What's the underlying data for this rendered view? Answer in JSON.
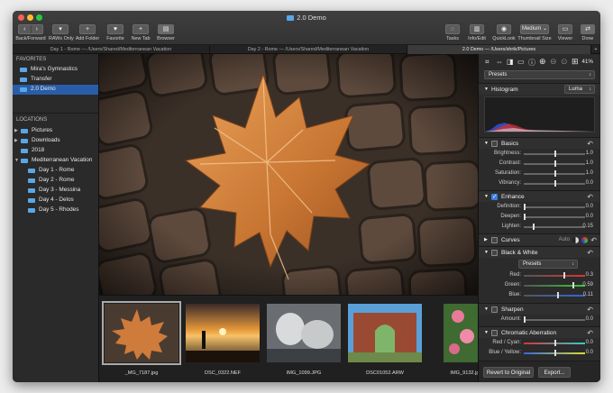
{
  "window": {
    "title": "2.0 Demo",
    "traffic_lights": {
      "close": "#fe5f57",
      "minimize": "#febc2e",
      "zoom": "#28c840"
    }
  },
  "toolbar": {
    "back_forward": "Back/Forward",
    "raws_only": "RAWs Only",
    "add_folder": "Add Folder",
    "favorite": "Favorite",
    "new_tab": "New Tab",
    "browser": "Browser",
    "tasks": "Tasks",
    "info_edit": "Info/Edit",
    "quicklook": "QuickLook",
    "thumbnail_size_value": "Medium",
    "thumbnail_size": "Thumbnail Size",
    "viewer": "Viewer",
    "done": "Done"
  },
  "tabs": [
    {
      "label": "Day 1 - Rome  —  /Users/Shared/Mediterranean Vacation",
      "active": false
    },
    {
      "label": "Day 2 - Rome  —  /Users/Shared/Mediterranean Vacation",
      "active": false
    },
    {
      "label": "2.0 Demo  —  /Users/shrik/Pictures",
      "active": true
    }
  ],
  "sidebar": {
    "favorites_header": "FAVORITES",
    "favorites": [
      {
        "label": "Mira's Gymnastics",
        "selected": false
      },
      {
        "label": "Transfer",
        "selected": false
      },
      {
        "label": "2.0 Demo",
        "selected": true
      }
    ],
    "locations_header": "LOCATIONS",
    "locations": [
      {
        "label": "Pictures",
        "expandable": true,
        "level": 0
      },
      {
        "label": "Downloads",
        "expandable": true,
        "level": 0
      },
      {
        "label": "2018",
        "expandable": false,
        "level": 0
      },
      {
        "label": "Mediterranean Vacation",
        "expandable": true,
        "expanded": true,
        "level": 0
      },
      {
        "label": "Day 1 - Rome",
        "level": 1
      },
      {
        "label": "Day 2 - Rome",
        "level": 1
      },
      {
        "label": "Day 3 - Messina",
        "level": 1
      },
      {
        "label": "Day 4 - Delos",
        "level": 1
      },
      {
        "label": "Day 5 - Rhodes",
        "level": 1
      }
    ]
  },
  "filmstrip": [
    {
      "name": "_MG_7187.jpg",
      "selected": true
    },
    {
      "name": "DSC_0322.NEF",
      "selected": false
    },
    {
      "name": "IMG_1099.JPG",
      "selected": false
    },
    {
      "name": "DSC01052.ARW",
      "selected": false
    },
    {
      "name": "IMG_9132.jpg",
      "selected": false
    }
  ],
  "panel": {
    "zoom": "41%",
    "presets": "Presets",
    "histogram": {
      "label": "Histogram",
      "mode": "Luma"
    },
    "basics": {
      "label": "Basics",
      "enabled": false,
      "sliders": [
        {
          "label": "Brightness:",
          "value": "1.0",
          "level": 0.5
        },
        {
          "label": "Contrast:",
          "value": "1.0",
          "level": 0.5
        },
        {
          "label": "Saturation:",
          "value": "1.0",
          "level": 0.5
        },
        {
          "label": "Vibrancy:",
          "value": "0.0",
          "level": 0.5
        }
      ]
    },
    "enhance": {
      "label": "Enhance",
      "enabled": true,
      "sliders": [
        {
          "label": "Definition:",
          "value": "0.0",
          "level": 0.0
        },
        {
          "label": "Deepen:",
          "value": "0.0",
          "level": 0.0
        },
        {
          "label": "Lighten:",
          "value": "0.15",
          "level": 0.15
        }
      ]
    },
    "curves": {
      "label": "Curves",
      "auto": "Auto"
    },
    "black_white": {
      "label": "Black & White",
      "enabled": false,
      "presets": "Presets",
      "sliders": [
        {
          "label": "Red:",
          "value": "0.3",
          "level": 0.65
        },
        {
          "label": "Green:",
          "value": "0.59",
          "level": 0.8
        },
        {
          "label": "Blue:",
          "value": "0.11",
          "level": 0.55
        }
      ]
    },
    "sharpen": {
      "label": "Sharpen",
      "enabled": false,
      "sliders": [
        {
          "label": "Amount:",
          "value": "0.0",
          "level": 0.0
        }
      ]
    },
    "chromatic": {
      "label": "Chromatic Aberration",
      "enabled": false,
      "sliders": [
        {
          "label": "Red / Cyan:",
          "value": "0.0",
          "level": 0.5
        },
        {
          "label": "Blue / Yellow:",
          "value": "0.0",
          "level": 0.5
        }
      ]
    },
    "revert_button": "Revert to Original",
    "export_button": "Export..."
  }
}
